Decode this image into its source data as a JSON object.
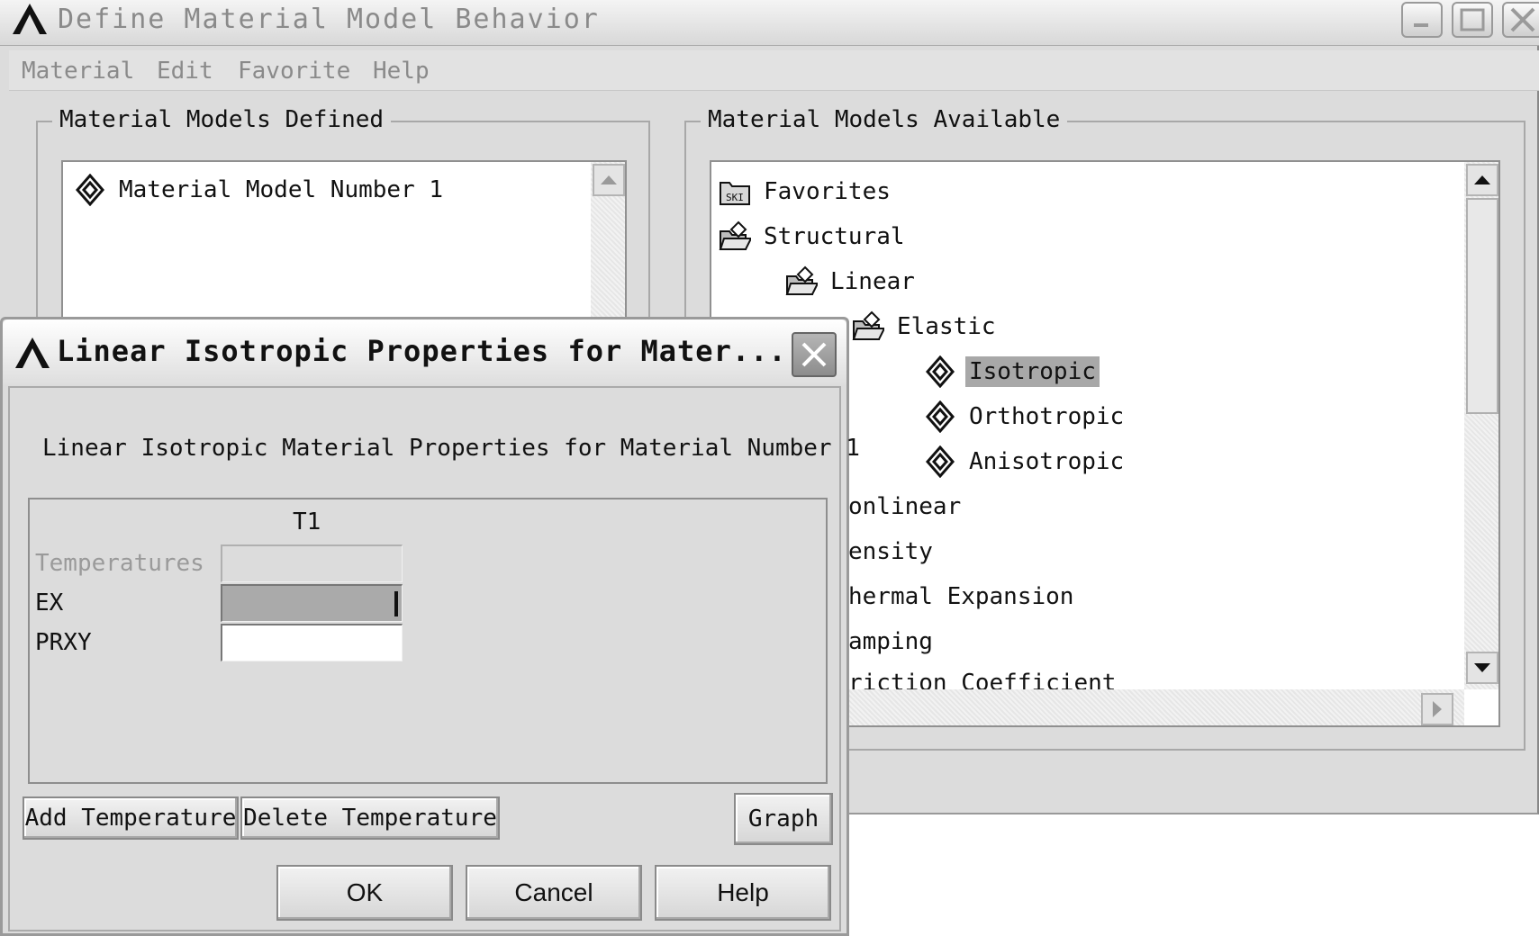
{
  "main_window": {
    "title": "Define Material Model Behavior",
    "menu": [
      "Material",
      "Edit",
      "Favorite",
      "Help"
    ]
  },
  "defined_panel": {
    "legend": "Material Models Defined",
    "items": [
      "Material Model Number 1"
    ]
  },
  "available_panel": {
    "legend": "Material Models Available",
    "tree": [
      {
        "label": "Favorites",
        "icon": "favorites-folder-icon",
        "level": 0,
        "selected": false
      },
      {
        "label": "Structural",
        "icon": "open-folder-icon",
        "level": 0,
        "selected": false
      },
      {
        "label": "Linear",
        "icon": "open-folder-icon",
        "level": 1,
        "selected": false
      },
      {
        "label": "Elastic",
        "icon": "open-folder-icon",
        "level": 2,
        "selected": false
      },
      {
        "label": "Isotropic",
        "icon": "material-model-icon",
        "level": 3,
        "selected": true
      },
      {
        "label": "Orthotropic",
        "icon": "material-model-icon",
        "level": 3,
        "selected": false
      },
      {
        "label": "Anisotropic",
        "icon": "material-model-icon",
        "level": 3,
        "selected": false
      },
      {
        "label": "onlinear",
        "icon": "",
        "level": 1,
        "selected": false
      },
      {
        "label": "ensity",
        "icon": "",
        "level": 1,
        "selected": false
      },
      {
        "label": "hermal Expansion",
        "icon": "",
        "level": 1,
        "selected": false
      },
      {
        "label": "amping",
        "icon": "",
        "level": 1,
        "selected": false
      },
      {
        "label": "riction Coefficient",
        "icon": "",
        "level": 1,
        "selected": false
      }
    ]
  },
  "dialog": {
    "title": "Linear Isotropic Properties for Mater...",
    "heading": "Linear Isotropic Material Properties for Material Number 1",
    "column": "T1",
    "rows": [
      {
        "label": "Temperatures",
        "value": "",
        "disabled": true
      },
      {
        "label": "EX",
        "value": "",
        "focused": true
      },
      {
        "label": "PRXY",
        "value": ""
      }
    ],
    "buttons": {
      "add_temperature": "Add Temperature",
      "delete_temperature": "Delete Temperature",
      "graph": "Graph",
      "ok": "OK",
      "cancel": "Cancel",
      "help": "Help"
    }
  },
  "colors": {
    "window_bg": "#dcdcdc",
    "selection": "#a8a8a8",
    "focused_cell": "#aaaaaa",
    "disabled_text": "#9a9a9a"
  }
}
